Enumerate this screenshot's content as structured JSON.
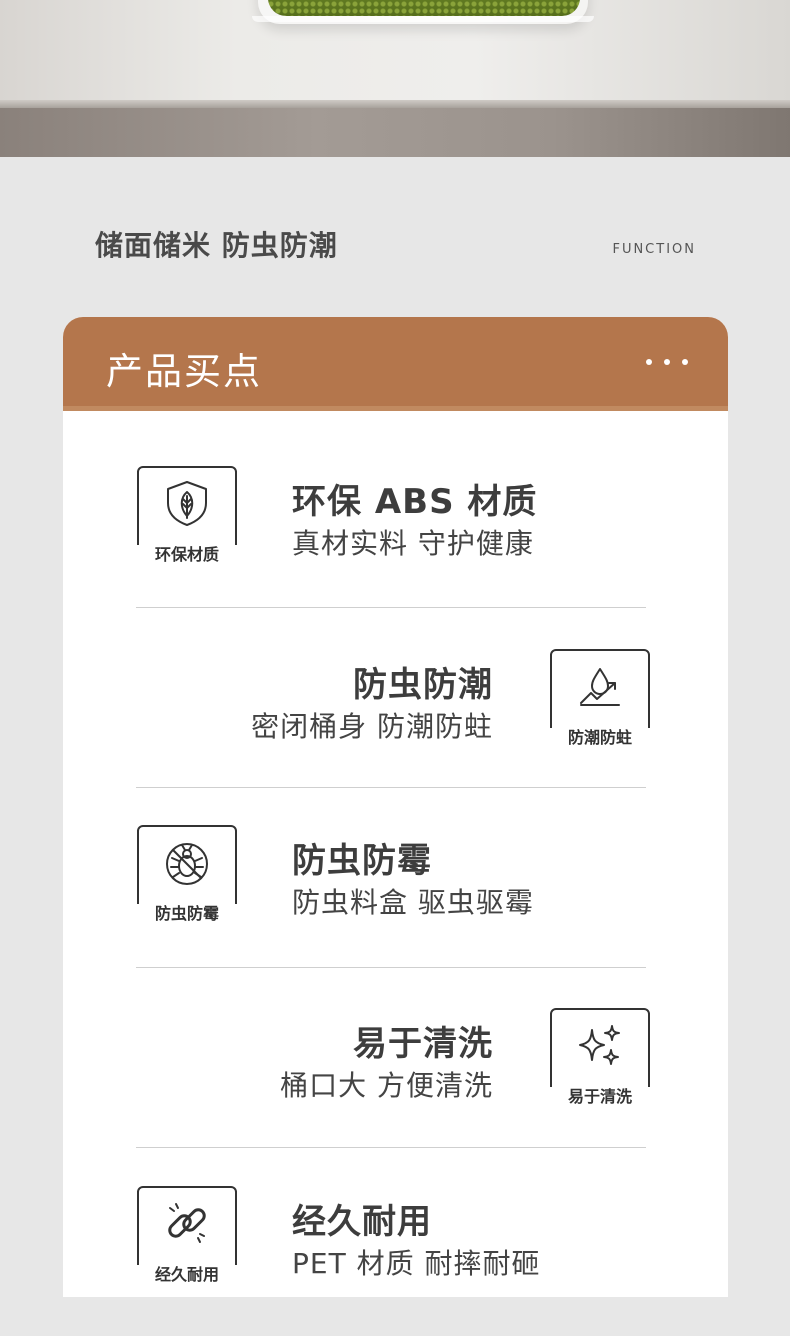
{
  "section": {
    "title": "储面储米 防虫防潮",
    "subtitle": "FUNCTION"
  },
  "card": {
    "title": "产品买点"
  },
  "features": [
    {
      "icon": "leaf-shield-icon",
      "badge": "环保材质",
      "title": "环保 ABS 材质",
      "subtitle": "真材实料 守护健康"
    },
    {
      "icon": "water-drop-icon",
      "badge": "防潮防蛀",
      "title": "防虫防潮",
      "subtitle": "密闭桶身 防潮防蛀"
    },
    {
      "icon": "no-bug-icon",
      "badge": "防虫防霉",
      "title": "防虫防霉",
      "subtitle": "防虫料盒 驱虫驱霉"
    },
    {
      "icon": "sparkle-icon",
      "badge": "易于清洗",
      "title": "易于清洗",
      "subtitle": "桶口大 方便清洗"
    },
    {
      "icon": "chain-link-icon",
      "badge": "经久耐用",
      "title": "经久耐用",
      "subtitle": "PET 材质 耐摔耐砸"
    }
  ],
  "colors": {
    "accent": "#b4764c",
    "text": "#3d3d3d"
  }
}
